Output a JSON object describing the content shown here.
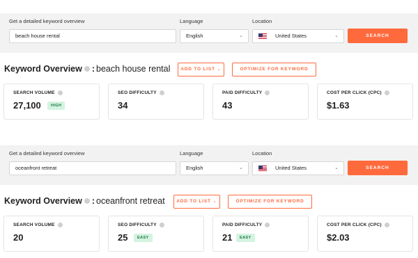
{
  "blocks": [
    {
      "search": {
        "keyword_label": "Get a detailed keyword overview",
        "keyword_value": "beach house rental",
        "language_label": "Language",
        "language_value": "English",
        "location_label": "Location",
        "location_value": "United States",
        "search_button": "SEARCH"
      },
      "overview": {
        "title": "Keyword Overview",
        "separator": ":",
        "keyword": "beach house rental",
        "add_to_list": "ADD TO LIST",
        "optimize": "OPTIMIZE FOR KEYWORD"
      },
      "metrics": [
        {
          "label": "SEARCH VOLUME",
          "value": "27,100",
          "badge": "HIGH"
        },
        {
          "label": "SEO DIFFICULTY",
          "value": "34",
          "badge": ""
        },
        {
          "label": "PAID DIFFICULTY",
          "value": "43",
          "badge": ""
        },
        {
          "label": "COST PER CLICK (CPC)",
          "value": "$1.63",
          "badge": ""
        }
      ]
    },
    {
      "search": {
        "keyword_label": "Get a detailed keyword overview",
        "keyword_value": "oceanfront retreat",
        "language_label": "Language",
        "language_value": "English",
        "location_label": "Location",
        "location_value": "United States",
        "search_button": "SEARCH"
      },
      "overview": {
        "title": "Keyword Overview",
        "separator": ":",
        "keyword": "oceanfront retreat",
        "add_to_list": "ADD TO LIST",
        "optimize": "OPTIMIZE FOR KEYWORD"
      },
      "metrics": [
        {
          "label": "SEARCH VOLUME",
          "value": "20",
          "badge": ""
        },
        {
          "label": "SEO DIFFICULTY",
          "value": "25",
          "badge": "EASY"
        },
        {
          "label": "PAID DIFFICULTY",
          "value": "21",
          "badge": "EASY"
        },
        {
          "label": "COST PER CLICK (CPC)",
          "value": "$2.03",
          "badge": ""
        }
      ]
    }
  ],
  "icons": {
    "info": "info-icon",
    "dropdown": "chevron-down-icon",
    "flag": "us-flag-icon"
  },
  "colors": {
    "accent": "#ff6a3d",
    "panel_bg": "#f2f2f2",
    "badge_bg": "#d4f3e1",
    "badge_text": "#1a7a45"
  }
}
